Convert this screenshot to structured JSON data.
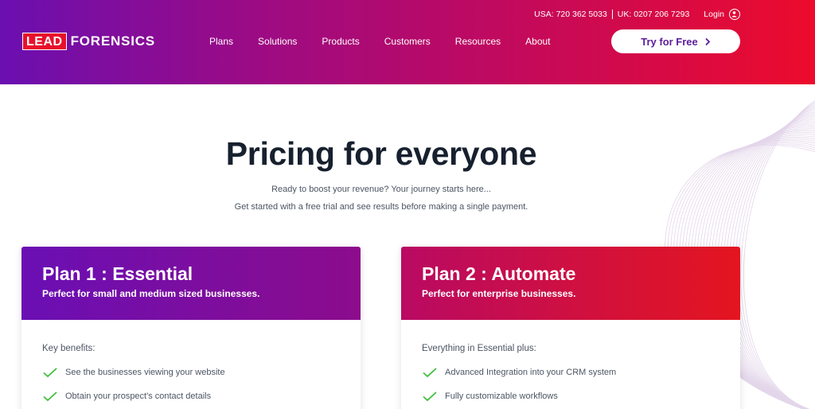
{
  "header": {
    "phone_usa": "USA: 720 362 5033",
    "phone_uk": "UK: 0207 206 7293",
    "login_label": "Login",
    "logo_lead": "LEAD",
    "logo_forensics": "FORENSICS",
    "nav": [
      "Plans",
      "Solutions",
      "Products",
      "Customers",
      "Resources",
      "About"
    ],
    "cta_label": "Try for Free",
    "cta_icon": "chevron-right-icon"
  },
  "hero": {
    "title": "Pricing for everyone",
    "subtitle_1": "Ready to boost your revenue? Your journey starts here...",
    "subtitle_2": "Get started with a free trial and see results before making a single payment."
  },
  "plans": [
    {
      "title": "Plan 1 : Essential",
      "tagline": "Perfect for small and medium sized businesses.",
      "benefits_label": "Key benefits:",
      "benefits": [
        "See the businesses viewing your website",
        "Obtain your prospect's contact details"
      ]
    },
    {
      "title": "Plan 2 : Automate",
      "tagline": "Perfect for enterprise businesses.",
      "benefits_label": "Everything in Essential plus:",
      "benefits": [
        "Advanced Integration into your CRM system",
        "Fully customizable workflows"
      ]
    }
  ],
  "colors": {
    "gradient_start": "#6a0fb0",
    "gradient_end": "#ec0b2c",
    "check_green": "#3fbf3f",
    "cta_text": "#5c1c9c"
  }
}
